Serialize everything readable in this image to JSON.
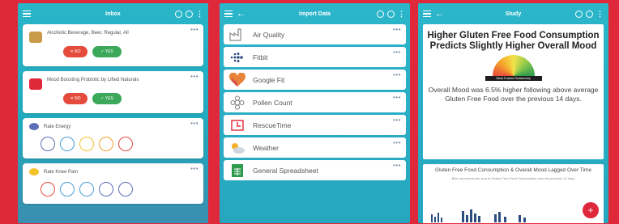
{
  "phone1": {
    "title": "Inbox",
    "cards": [
      {
        "text": "Alcoholic Beverage, Beer, Regular, All",
        "no_label": "✕ NO",
        "yes_label": "✓ YES"
      },
      {
        "text": "Mood Boosting Probiotic by Lifted Naturals",
        "no_label": "✕ NO",
        "yes_label": "✓ YES"
      }
    ],
    "ratings": [
      {
        "label": "Rate Energy"
      },
      {
        "label": "Rate Knee Pain"
      }
    ],
    "more": "•••"
  },
  "phone2": {
    "title": "Import Data",
    "items": [
      {
        "label": "Air Quality",
        "icon": "factory-icon"
      },
      {
        "label": "Fitbit",
        "icon": "fitbit-icon"
      },
      {
        "label": "Google Fit",
        "icon": "heart-icon"
      },
      {
        "label": "Pollen Count",
        "icon": "flower-icon"
      },
      {
        "label": "RescueTime",
        "icon": "clock-icon"
      },
      {
        "label": "Weather",
        "icon": "weather-icon"
      },
      {
        "label": "General Spreadsheet",
        "icon": "spreadsheet-icon"
      }
    ],
    "more": "•••"
  },
  "phone3": {
    "title": "Study",
    "heading": "Higher Gluten Free Food Consumption Predicts Slightly Higher Overall Mood",
    "gauge_label": "Weak Positive Relationship",
    "summary": "Overall Mood was 6.5% higher following above average Gluten Free Food over the previous 14 days.",
    "chart_title": "Gluten Free Food Consumption & Overall Mood Lagged Over Time",
    "chart_subtitle": "Blue represents the sum of Gluten Free Food Consumption over the previous 14 days",
    "fab": "+"
  },
  "colors": {
    "background": "#e0283b",
    "teal": "#29b6c9",
    "no": "#e54b3c",
    "yes": "#3ca85a"
  }
}
